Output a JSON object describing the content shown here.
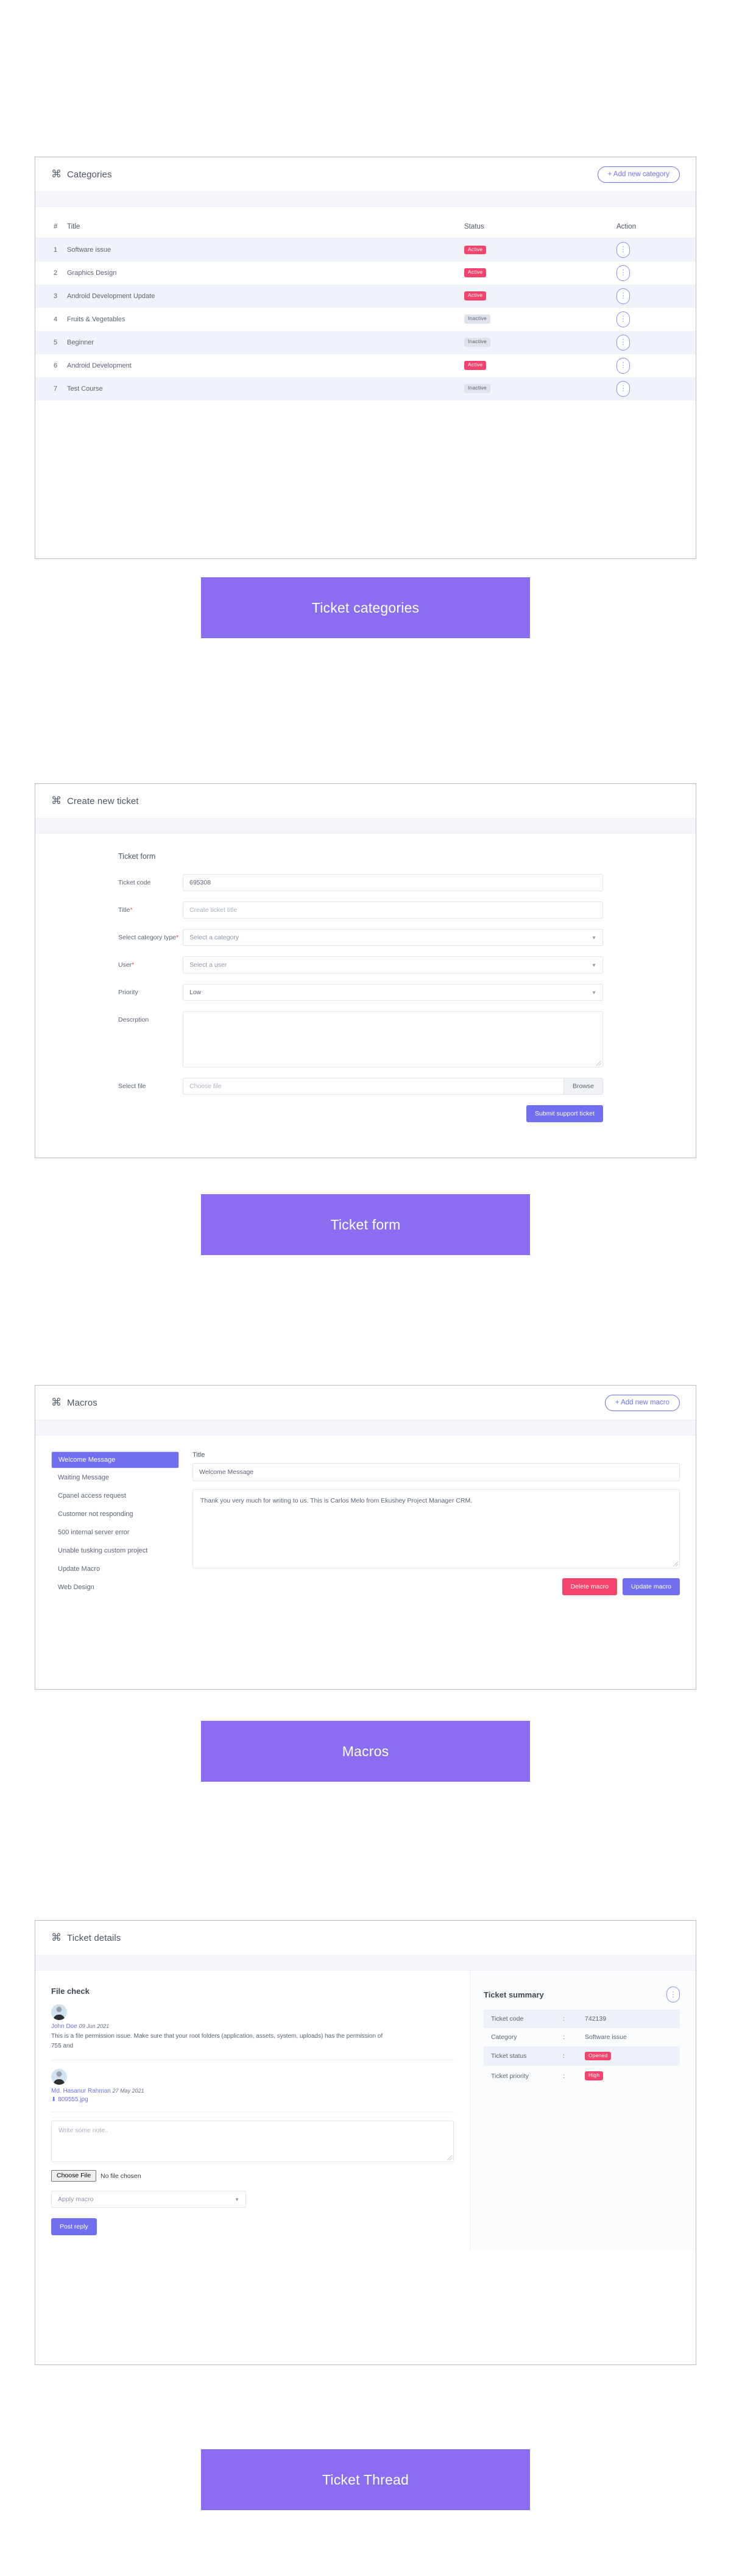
{
  "sections": {
    "categories": {
      "icon": "command-icon",
      "title": "Categories",
      "add_button": "+ Add new category",
      "columns": [
        "#",
        "Title",
        "Status",
        "Action"
      ],
      "rows": [
        {
          "num": "1",
          "title": "Software issue",
          "status": "Active",
          "status_type": "active",
          "action": "⋮"
        },
        {
          "num": "2",
          "title": "Graphics Design",
          "status": "Active",
          "status_type": "active",
          "action": "⋮"
        },
        {
          "num": "3",
          "title": "Android Development Update",
          "status": "Active",
          "status_type": "active",
          "action": "⋮"
        },
        {
          "num": "4",
          "title": "Fruits & Vegetables",
          "status": "Inactive",
          "status_type": "inactive",
          "action": "⋮"
        },
        {
          "num": "5",
          "title": "Beginner",
          "status": "Inactive",
          "status_type": "inactive",
          "action": "⋮"
        },
        {
          "num": "6",
          "title": "Android Development",
          "status": "Active",
          "status_type": "active",
          "action": "⋮"
        },
        {
          "num": "7",
          "title": "Test Course",
          "status": "Inactive",
          "status_type": "inactive",
          "action": "⋮"
        }
      ],
      "banner": "Ticket categories"
    },
    "ticket_form": {
      "icon": "command-icon",
      "title": "Create new ticket",
      "form_title": "Ticket form",
      "fields": {
        "ticket_code": {
          "label": "Ticket code",
          "value": "695308"
        },
        "title": {
          "label": "Title",
          "required": "*",
          "placeholder": "Create ticket title"
        },
        "category": {
          "label": "Select category type",
          "required": "*",
          "value": "Select a category"
        },
        "user": {
          "label": "User",
          "required": "*",
          "value": "Select a user"
        },
        "priority": {
          "label": "Priority",
          "value": "Low"
        },
        "description": {
          "label": "Descrption",
          "value": ""
        },
        "file": {
          "label": "Select file",
          "placeholder": "Choose file",
          "browse": "Browse"
        }
      },
      "submit": "Submit support ticket",
      "banner": "Ticket form"
    },
    "macros": {
      "icon": "command-icon",
      "title": "Macros",
      "add_button": "+ Add new macro",
      "list": [
        "Welcome Message",
        "Waiting Message",
        "Cpanel access request",
        "Customer not responding",
        "500 internal server error",
        "Unable tusking custom project",
        "Update Macro",
        "Web Design"
      ],
      "selected_index": 0,
      "title_label": "Title",
      "title_value": "Welcome Message",
      "body_value": "Thank you very much for writing to us. This is Carlos Melo from Ekushey Project Manager CRM.",
      "delete_button": "Delete macro",
      "update_button": "Update macro",
      "banner": "Macros"
    },
    "ticket_details": {
      "icon": "command-icon",
      "title": "Ticket details",
      "thread_title": "File check",
      "messages": [
        {
          "author": "John Doe",
          "date": "09 Jun 2021",
          "text": "This is a file permission issue. Make sure that your root folders (application, assets, system, uploads) has the permission of 755 and",
          "attachment": ""
        },
        {
          "author": "Md. Hasanur Rahman",
          "date": "27 May 2021",
          "text": "",
          "attachment": "⬇ 809555.jpg"
        }
      ],
      "note_placeholder": "Write some note..",
      "choose_file_button": "Choose File",
      "no_file_text": "No file chosen",
      "apply_macro": "Apply macro",
      "post_reply": "Post reply",
      "summary": {
        "title": "Ticket summary",
        "menu_icon": "⋮",
        "rows": [
          {
            "key": "Ticket code",
            "sep": ":",
            "value": "742139",
            "badge": ""
          },
          {
            "key": "Category",
            "sep": ":",
            "value": "Software issue",
            "badge": ""
          },
          {
            "key": "Ticket status",
            "sep": ":",
            "value": "Opened",
            "badge": "opened"
          },
          {
            "key": "Ticket priority",
            "sep": ":",
            "value": "High",
            "badge": "high"
          }
        ]
      },
      "banner": "Ticket Thread"
    }
  },
  "colors": {
    "accent_purple": "#8a6df0",
    "brand_indigo": "#6f6ff0",
    "danger_pink": "#f4436c",
    "muted_badge": "#dfe3ec"
  }
}
